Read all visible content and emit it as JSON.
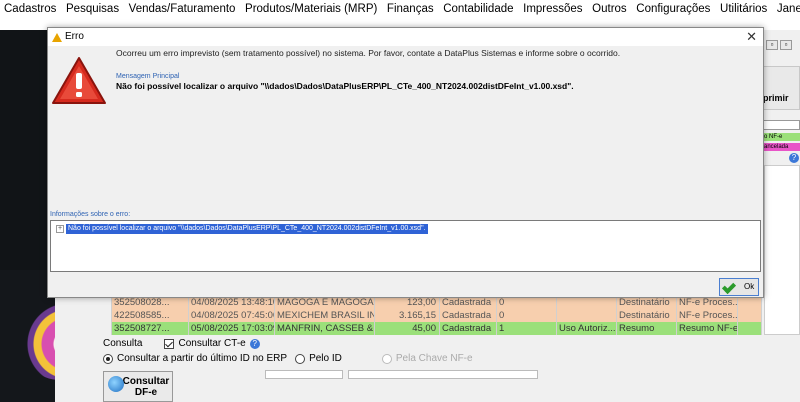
{
  "menu": [
    "Cadastros",
    "Pesquisas",
    "Vendas/Faturamento",
    "Produtos/Materiais (MRP)",
    "Finanças",
    "Contabilidade",
    "Impressões",
    "Outros",
    "Configurações",
    "Utilitários",
    "Janelas"
  ],
  "background": {
    "imprimir_label": "primir",
    "tag_green": "o NF-e",
    "tag_pink": "ancelada",
    "rows": [
      {
        "style": "salmon",
        "cells": [
          "352508028...",
          "04/08/2025 13:48:10",
          "MAGOGA E MAGOGA...",
          "123,00",
          "Cadastrada",
          "0",
          "",
          "Destinatário",
          "NF-e Proces...",
          ""
        ]
      },
      {
        "style": "salmon",
        "cells": [
          "422508585...",
          "04/08/2025 07:45:06",
          "MEXICHEM BRASIL IN...",
          "3.165,15",
          "Cadastrada",
          "0",
          "",
          "Destinatário",
          "NF-e Proces...",
          ""
        ]
      },
      {
        "style": "green",
        "cells": [
          "352508727...",
          "05/08/2025 17:03:09",
          "MANFRIN, CASSEB &...",
          "45,00",
          "Cadastrada",
          "1",
          "Uso Autoriz...",
          "Resumo",
          "Resumo NF-e",
          ""
        ]
      }
    ],
    "consulta_label": "Consulta",
    "consultar_cte_label": "Consultar CT-e",
    "radio_ultimo_label": "Consultar a partir do último ID no ERP",
    "radio_pelo_id_label": "Pelo ID",
    "radio_chave_label": "Pela Chave NF-e",
    "consultar_btn_line1": "Consultar",
    "consultar_btn_line2": "DF-e"
  },
  "dialog": {
    "title": "Erro",
    "message": "Ocorreu um erro imprevisto (sem tratamento possível) no sistema. Por favor, contate a DataPlus Sistemas e informe sobre o ocorrido.",
    "main_label": "Mensagem Principal",
    "main_message": "Não foi possível localizar o arquivo \"\\\\dados\\Dados\\DataPlusERP\\PL_CTe_400_NT2024.002distDFeInt_v1.00.xsd\".",
    "info_label": "Informações sobre o erro:",
    "info_item": "Não foi possível localizar o arquivo \"\\\\dados\\Dados\\DataPlusERP\\PL_CTe_400_NT2024.002distDFeInt_v1.00.xsd\".",
    "ok_label": "Ok"
  },
  "icons": {
    "title_icon": "warning-icon",
    "big_icon": "error-warning-icon",
    "close_icon": "close-icon",
    "ok_icon": "check-icon"
  },
  "colors": {
    "warning_red": "#d62a1e",
    "row_salmon": "#f7cfae",
    "row_green": "#9be07a",
    "selection_blue": "#2f63d6",
    "link_blue": "#2f63b3"
  }
}
